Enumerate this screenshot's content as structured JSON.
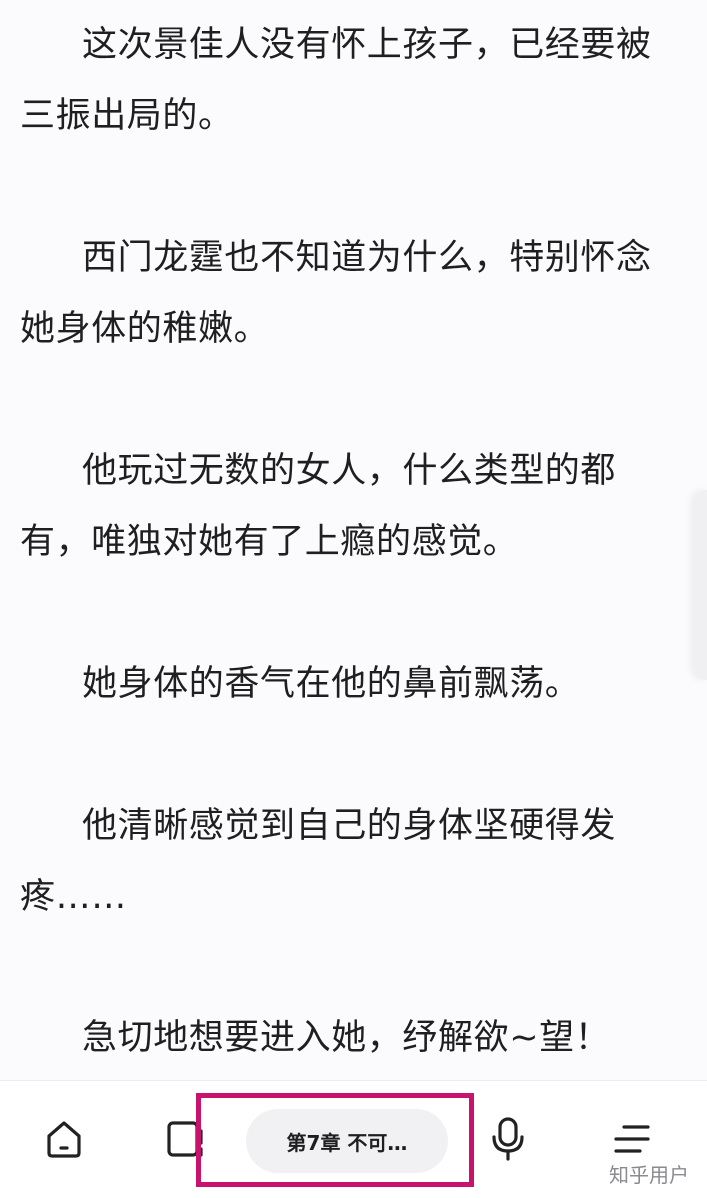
{
  "content": {
    "paragraphs": [
      {
        "lines": [
          "这次景佳人没有怀上孩子，已经要被",
          "三振出局的。"
        ]
      },
      {
        "lines": [
          "西门龙霆也不知道为什么，特别怀念",
          "她身体的稚嫩。"
        ]
      },
      {
        "lines": [
          "他玩过无数的女人，什么类型的都",
          "有，唯独对她有了上瘾的感觉。"
        ]
      },
      {
        "lines": [
          "她身体的香气在他的鼻前飘荡。"
        ]
      },
      {
        "lines": [
          "他清晰感觉到自己的身体坚硬得发",
          "疼……"
        ]
      },
      {
        "lines": [
          "急切地想要进入她，纾解欲~望！"
        ]
      }
    ]
  },
  "bottom_bar": {
    "chapter_label": "第7章 不可…",
    "icons": [
      "home-icon",
      "bookshelf-icon",
      "microphone-icon",
      "menu-icon"
    ],
    "highlight_color": "#c8136e"
  },
  "watermark": "知乎用户"
}
